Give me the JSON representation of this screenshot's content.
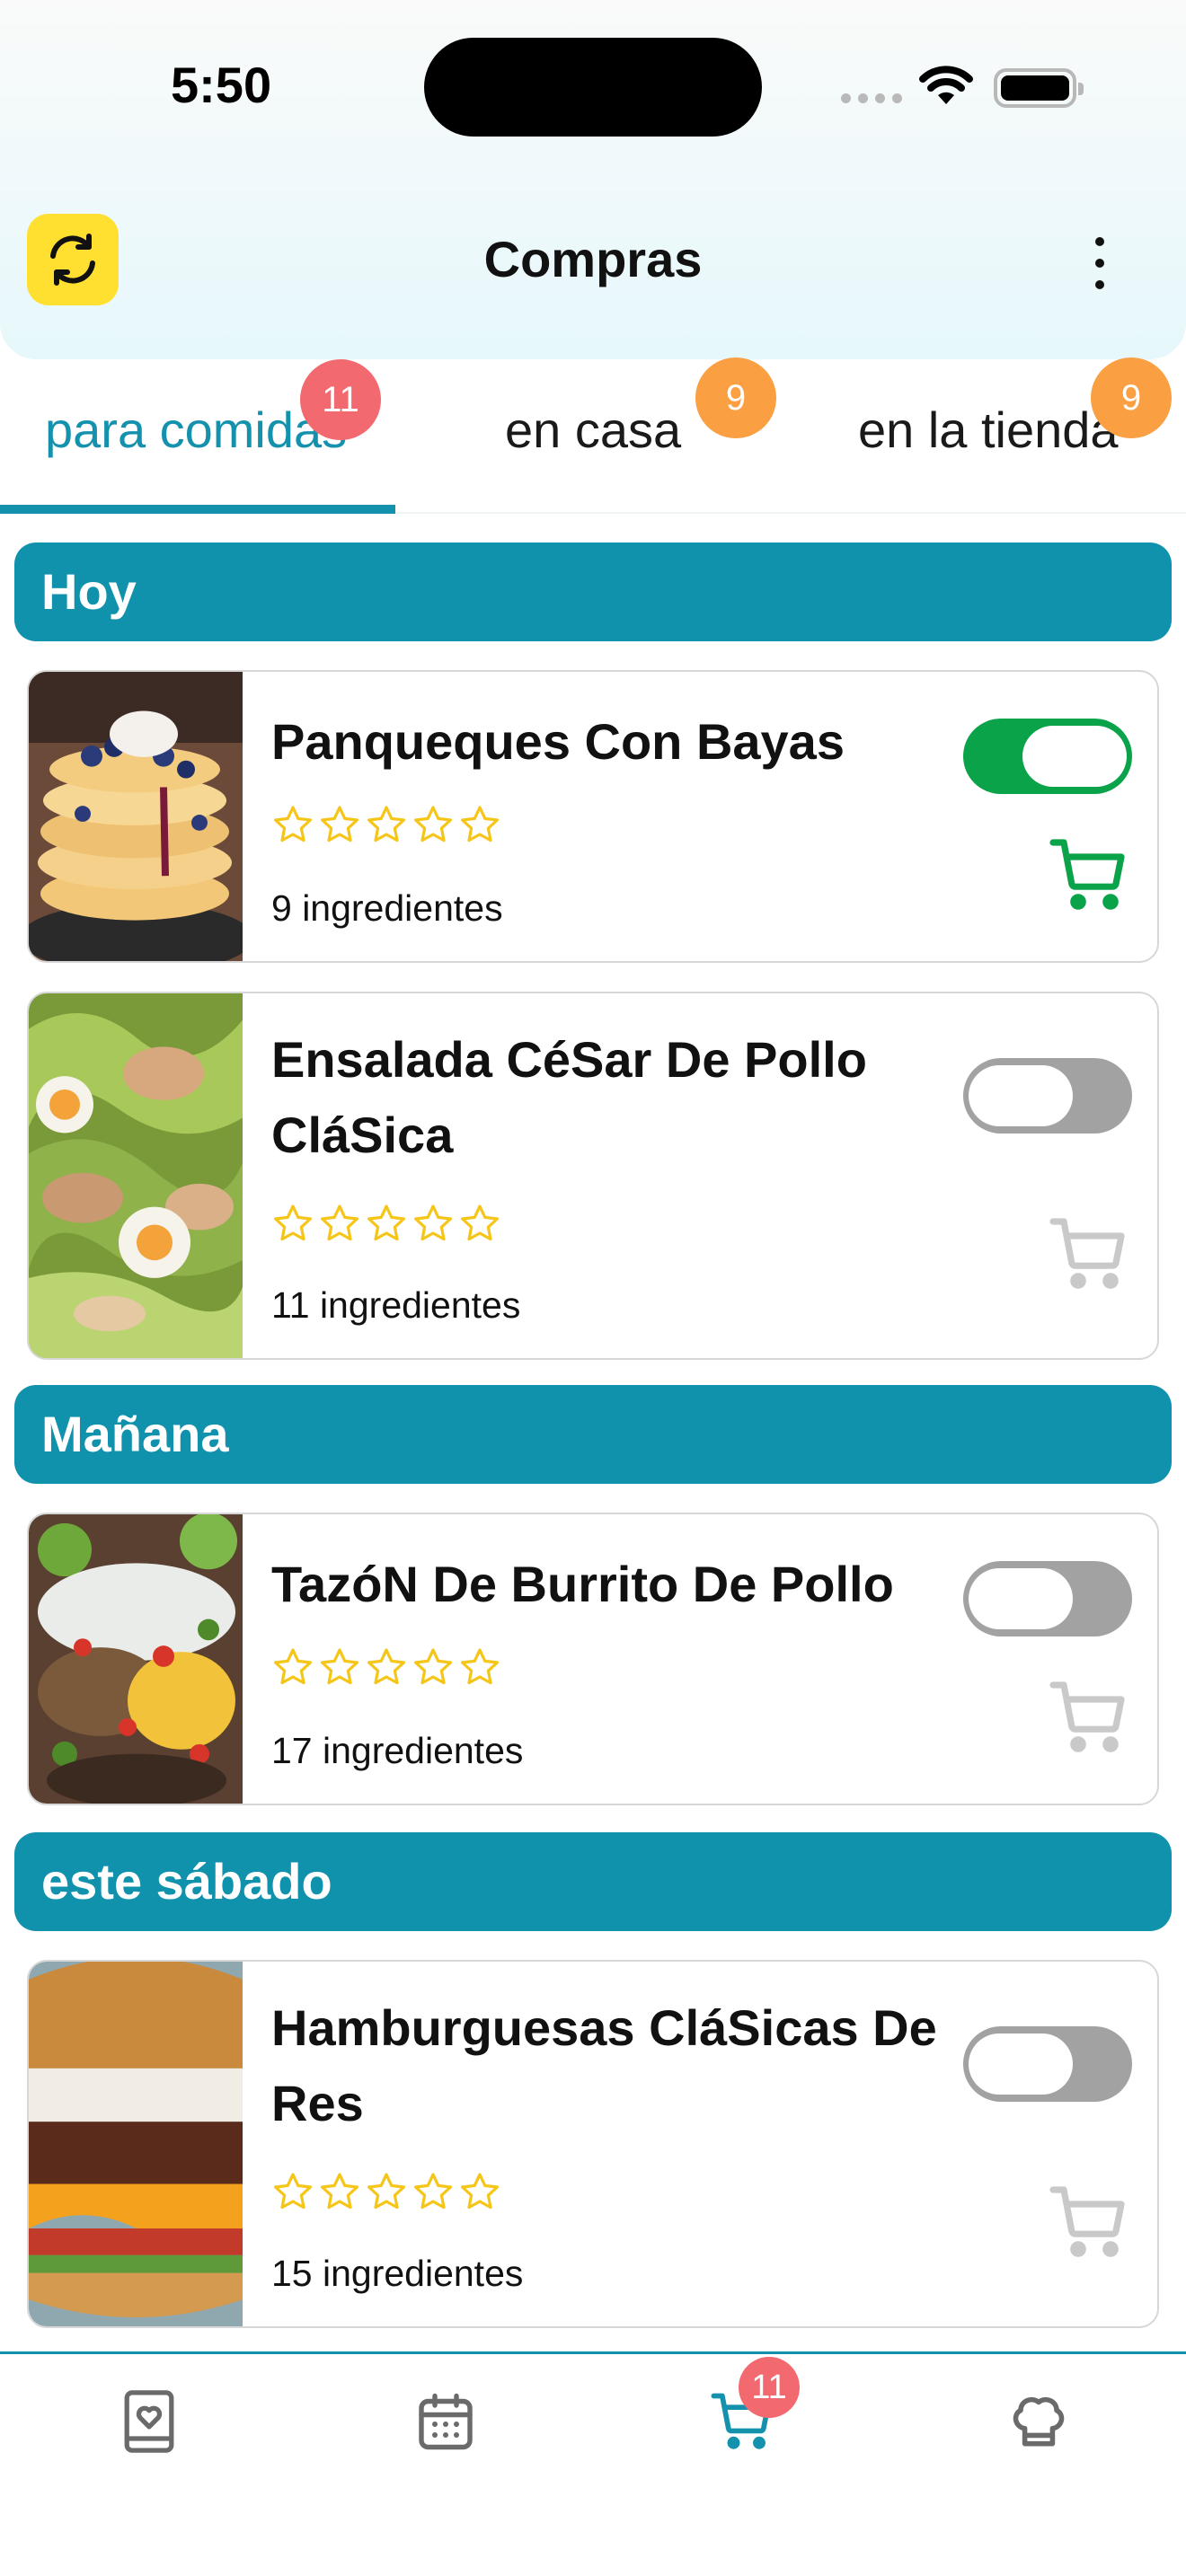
{
  "status_bar": {
    "time": "5:50"
  },
  "header": {
    "title": "Compras",
    "refresh_icon": "refresh-icon",
    "menu_icon": "more-vertical-icon",
    "accent_color": "#ffe030"
  },
  "tabs": [
    {
      "label": "para comidas",
      "badge": "11",
      "active": true
    },
    {
      "label": "en casa",
      "badge": "9",
      "active": false
    },
    {
      "label": "en la tienda",
      "badge": "9",
      "active": false
    }
  ],
  "sections": [
    {
      "title": "Hoy",
      "recipes": [
        {
          "name": "Panqueques Con Bayas",
          "rating": 0,
          "ingredients": "9 ingredientes",
          "toggle_on": true
        },
        {
          "name": "Ensalada CéSar De Pollo CláSica",
          "rating": 0,
          "ingredients": "11 ingredientes",
          "toggle_on": false
        }
      ]
    },
    {
      "title": "Mañana",
      "recipes": [
        {
          "name": "TazóN De Burrito De Pollo",
          "rating": 0,
          "ingredients": "17 ingredientes",
          "toggle_on": false
        }
      ]
    },
    {
      "title": "este sábado",
      "recipes": [
        {
          "name": "Hamburguesas CláSicas De Res",
          "rating": 0,
          "ingredients": "15 ingredientes",
          "toggle_on": false
        }
      ]
    }
  ],
  "bottom_nav": [
    {
      "icon": "recipe-book-icon",
      "active": false
    },
    {
      "icon": "calendar-icon",
      "active": false
    },
    {
      "icon": "cart-icon",
      "active": true,
      "badge": "11"
    },
    {
      "icon": "chef-hat-icon",
      "active": false
    }
  ],
  "colors": {
    "primary": "#1092ad",
    "toggle_on": "#0aa34a",
    "toggle_off": "#a2a2a2",
    "badge_red": "#f26a70",
    "badge_orange": "#fb9f43",
    "star": "#f5c518"
  }
}
